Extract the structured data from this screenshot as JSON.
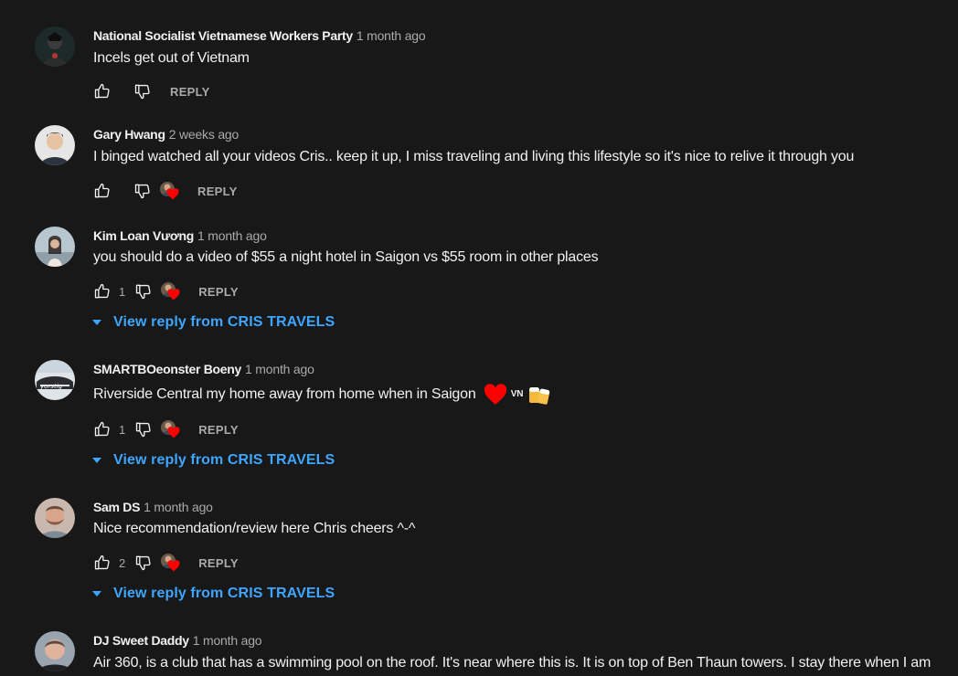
{
  "comments": [
    {
      "author": "National Socialist Vietnamese Workers Party",
      "time": "1 month ago",
      "text": "Incels get out of Vietnam",
      "likes": "",
      "reply_label": "REPLY"
    },
    {
      "author": "Gary Hwang",
      "time": "2 weeks ago",
      "text": "I binged watched all your videos Cris.. keep it up, I miss traveling and living this lifestyle so it's nice to relive it through you",
      "likes": "",
      "reply_label": "REPLY"
    },
    {
      "author": "Kim Loan Vương",
      "time": "1 month ago",
      "text": "you should do a video of $55 a night hotel in Saigon vs $55 room in other places",
      "likes": "1",
      "reply_label": "REPLY",
      "view_replies": "View reply from CRIS TRAVELS"
    },
    {
      "author": "SMARTBOeonster Boeny",
      "time": "1 month ago",
      "text": "Riverside Central my home away from home when in Saigon",
      "text_badge": "VN",
      "likes": "1",
      "reply_label": "REPLY",
      "view_replies": "View reply from CRIS TRAVELS"
    },
    {
      "author": "Sam DS",
      "time": "1 month ago",
      "text": "Nice recommendation/review here Chris cheers ^-^",
      "likes": "2",
      "reply_label": "REPLY",
      "view_replies": "View reply from CRIS TRAVELS"
    },
    {
      "author": "DJ Sweet Daddy",
      "time": "1 month ago",
      "text": "Air 360, is a club that has a swimming pool on the roof. It's near where this is. It is on top of Ben Thaun towers. I stay there when I am"
    }
  ],
  "icons": {
    "like": "thumb-up-icon",
    "dislike": "thumb-down-icon",
    "creator_heart": "creator-heart-icon",
    "expand": "caret-down-icon"
  },
  "colors": {
    "background": "#181818",
    "link": "#3ea6ff",
    "secondary_text": "#aaaaaa",
    "heart": "#ff0000"
  }
}
